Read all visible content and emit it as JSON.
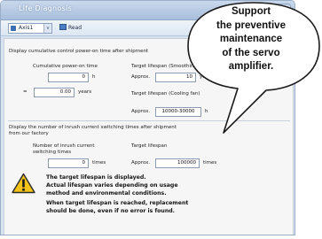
{
  "window": {
    "title": "Life Diagnosis",
    "close_label": "x"
  },
  "toolbar": {
    "axis_value": "Axis1",
    "axis_arrow": "v",
    "read_label": "Read"
  },
  "cumulative": {
    "heading": "Display cumulative control power-on time after shipment",
    "power_on_label": "Cumulative power-on time",
    "hours_value": "0",
    "hours_unit": "h",
    "equals": "=",
    "years_value": "0.00",
    "years_unit": "years",
    "target_smoothing_label": "Target lifespan (Smoothing capacitor)",
    "approx_label_1": "Approx.",
    "smoothing_value": "10",
    "smoothing_unit": "years",
    "target_fan_label": "Target lifespan (Cooling fan)",
    "approx_label_2": "Approx.",
    "fan_value": "10000-30000",
    "fan_unit": "h"
  },
  "inrush": {
    "heading_line1": "Display the number of inrush current switching times after shipment",
    "heading_line2": "from our factory",
    "count_label_line1": "Number of inrush current",
    "count_label_line2": "switching times",
    "count_value": "0",
    "count_unit": "times",
    "target_label": "Target lifespan",
    "approx_label": "Approx.",
    "target_value": "100000",
    "target_unit": "times"
  },
  "warning": {
    "icon": "warning-triangle-icon",
    "line1": "The target lifespan is displayed.",
    "line2": "Actual lifespan varies depending on usage",
    "line3": "method and environmental conditions.",
    "line4": "When target lifespan is reached, replacement",
    "line5": "should be done, even if no error is found."
  },
  "callout": {
    "line1": "Support",
    "line2": "the preventive",
    "line3": "maintenance",
    "line4": "of the servo",
    "line5": "amplifier."
  },
  "colors": {
    "window_bg": "#d7e2f0",
    "panel_bg": "#f6f6f6",
    "warning_fill": "#f3c31a"
  }
}
